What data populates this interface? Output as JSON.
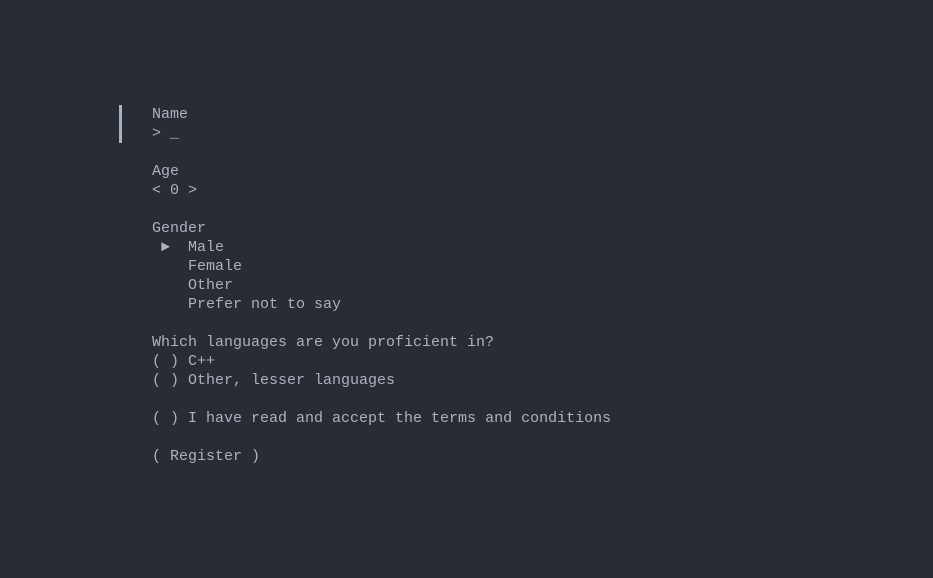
{
  "fields": {
    "name": {
      "label": "Name",
      "prompt": "> ",
      "cursor": "_"
    },
    "age": {
      "label": "Age",
      "left": "< ",
      "value": "0",
      "right": " >"
    },
    "gender": {
      "label": "Gender",
      "pointer": " ►  ",
      "indent": "    ",
      "options": [
        "Male",
        "Female",
        "Other",
        "Prefer not to say"
      ],
      "selected_index": 0
    },
    "languages": {
      "label": "Which languages are you proficient in?",
      "options": [
        {
          "marker": "( ) ",
          "text": "C++"
        },
        {
          "marker": "( ) ",
          "text": "Other, lesser languages"
        }
      ]
    },
    "terms": {
      "marker": "( ) ",
      "text": "I have read and accept the terms and conditions"
    },
    "register": {
      "text": "( Register )"
    }
  }
}
